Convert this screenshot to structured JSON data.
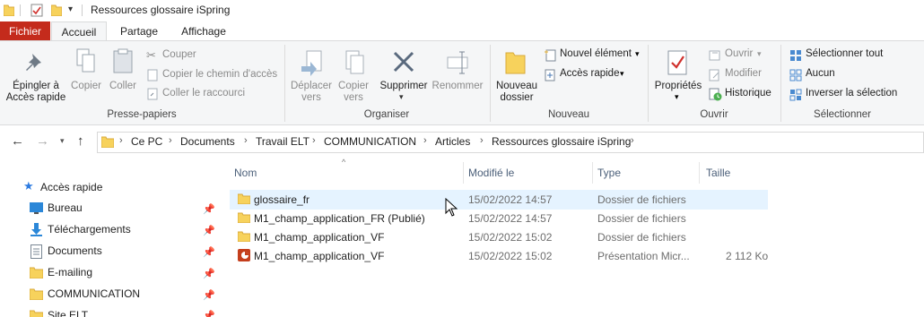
{
  "window": {
    "title": "Ressources glossaire iSpring"
  },
  "tabs": [
    {
      "label": "Fichier"
    },
    {
      "label": "Accueil"
    },
    {
      "label": "Partage"
    },
    {
      "label": "Affichage"
    }
  ],
  "ribbon": {
    "clipboard": {
      "pin_line1": "Épingler à",
      "pin_line2": "Accès rapide",
      "copy": "Copier",
      "paste": "Coller",
      "cut": "Couper",
      "copy_path": "Copier le chemin d'accès",
      "paste_shortcut": "Coller le raccourci",
      "group": "Presse-papiers"
    },
    "organize": {
      "move_line1": "Déplacer",
      "move_line2": "vers",
      "copyto_line1": "Copier",
      "copyto_line2": "vers",
      "delete": "Supprimer",
      "rename": "Renommer",
      "group": "Organiser"
    },
    "new": {
      "folder_line1": "Nouveau",
      "folder_line2": "dossier",
      "new_item": "Nouvel élément",
      "easy_access": "Accès rapide",
      "group": "Nouveau"
    },
    "open": {
      "properties": "Propriétés",
      "open": "Ouvrir",
      "edit": "Modifier",
      "history": "Historique",
      "group": "Ouvrir"
    },
    "select": {
      "all": "Sélectionner tout",
      "none": "Aucun",
      "invert": "Inverser la sélection",
      "group": "Sélectionner"
    }
  },
  "address": {
    "crumbs": [
      "Ce PC",
      "Documents",
      "Travail ELT",
      "COMMUNICATION",
      "Articles",
      "Ressources glossaire iSpring"
    ]
  },
  "nav": {
    "quick_access": "Accès rapide",
    "items": [
      {
        "label": "Bureau",
        "icon": "desktop-icon"
      },
      {
        "label": "Téléchargements",
        "icon": "download-icon"
      },
      {
        "label": "Documents",
        "icon": "documents-icon"
      },
      {
        "label": "E-mailing",
        "icon": "folder-icon"
      },
      {
        "label": "COMMUNICATION",
        "icon": "folder-icon"
      },
      {
        "label": "Site ELT",
        "icon": "folder-icon"
      }
    ]
  },
  "list": {
    "columns": {
      "name": "Nom",
      "date": "Modifié le",
      "type": "Type",
      "size": "Taille"
    },
    "rows": [
      {
        "name": "glossaire_fr",
        "date": "15/02/2022 14:57",
        "type": "Dossier de fichiers",
        "size": "",
        "icon": "folder-icon"
      },
      {
        "name": "M1_champ_application_FR (Publié)",
        "date": "15/02/2022 14:57",
        "type": "Dossier de fichiers",
        "size": "",
        "icon": "folder-icon"
      },
      {
        "name": "M1_champ_application_VF",
        "date": "15/02/2022 15:02",
        "type": "Dossier de fichiers",
        "size": "",
        "icon": "folder-icon"
      },
      {
        "name": "M1_champ_application_VF",
        "date": "15/02/2022 15:02",
        "type": "Présentation Micr...",
        "size": "2 112 Ko",
        "icon": "powerpoint-icon"
      }
    ]
  },
  "colors": {
    "file_tab": "#c42b1c",
    "folder": "#f7d25c",
    "selected_row": "#e5f3ff",
    "ppt": "#c43e1c"
  }
}
